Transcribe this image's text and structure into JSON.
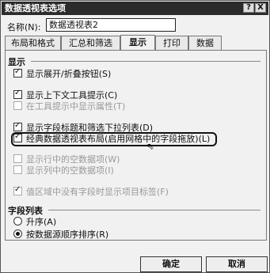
{
  "window": {
    "title": "数据透视表选项",
    "help": "?",
    "close": "X"
  },
  "name": {
    "label": "名称(N):",
    "value": "数据透视表2"
  },
  "tabs": [
    {
      "label": "布局和格式"
    },
    {
      "label": "汇总和筛选"
    },
    {
      "label": "显示"
    },
    {
      "label": "打印"
    },
    {
      "label": "数据"
    }
  ],
  "display": {
    "group_label": "显示",
    "items": [
      {
        "label": "显示展开/折叠按钮(S)",
        "checked": true,
        "enabled": true
      },
      {
        "label": "显示上下文工具提示(C)",
        "checked": true,
        "enabled": true
      },
      {
        "label": "在工具提示中显示属性(T)",
        "checked": false,
        "enabled": false
      },
      {
        "label": "显示字段标题和筛选下拉列表(D)",
        "checked": true,
        "enabled": true
      },
      {
        "label": "经典数据透视表布局(启用网格中的字段拖放)(L)",
        "checked": true,
        "enabled": true
      },
      {
        "label": "显示行中的空数据项(W)",
        "checked": false,
        "enabled": false
      },
      {
        "label": "显示列中的空数据项(I)",
        "checked": false,
        "enabled": false
      },
      {
        "label": "值区域中没有字段时显示项目标签(F)",
        "checked": true,
        "enabled": false
      }
    ]
  },
  "field_list": {
    "group_label": "字段列表",
    "options": [
      {
        "label": "升序(A)",
        "selected": false
      },
      {
        "label": "按数据源顺序排序(R)",
        "selected": true
      }
    ]
  },
  "buttons": {
    "ok": "确定",
    "cancel": "取消"
  }
}
